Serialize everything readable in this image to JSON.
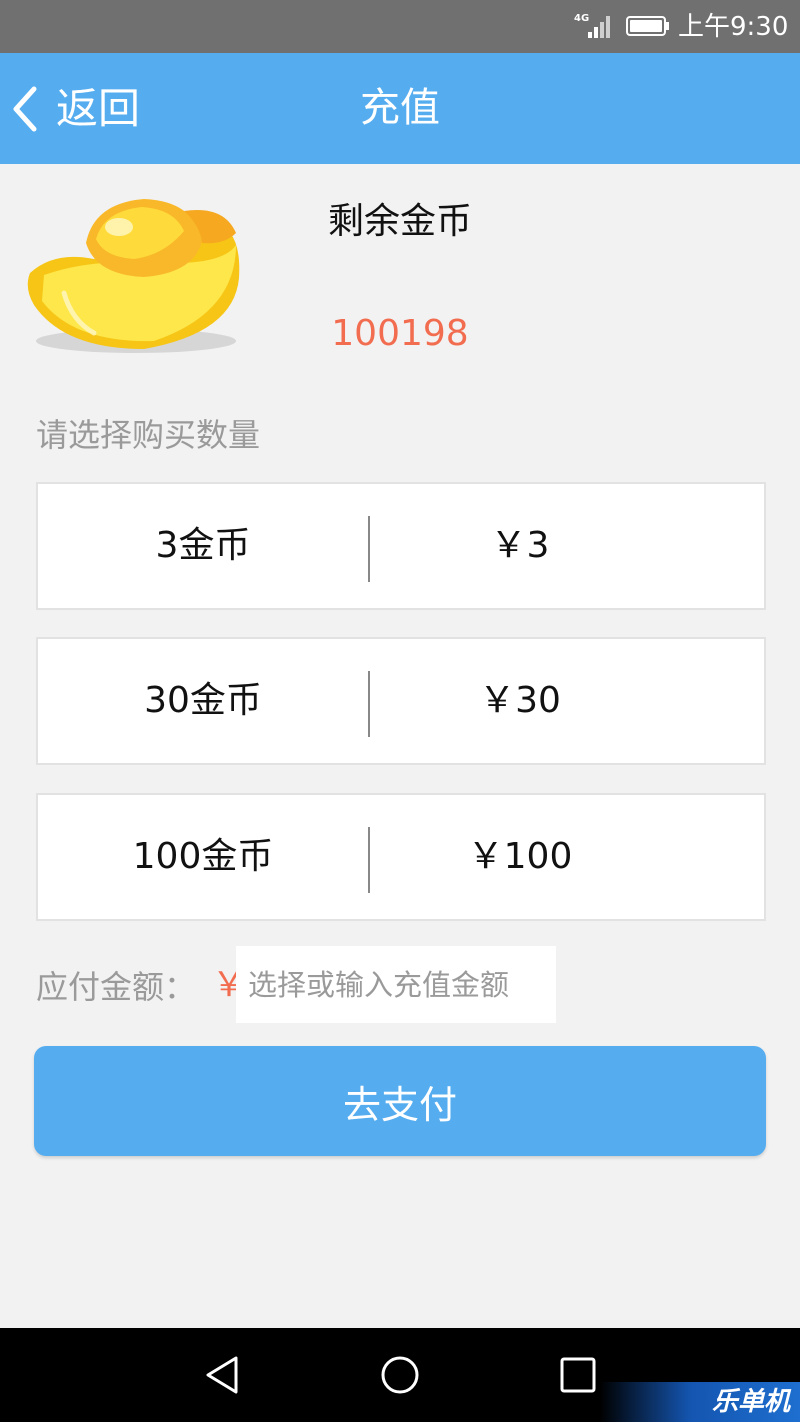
{
  "status_bar": {
    "network": "4G",
    "time": "上午9:30"
  },
  "nav": {
    "back_label": "返回",
    "title": "充值"
  },
  "balance": {
    "label": "剩余金币",
    "value": "100198"
  },
  "section_label": "请选择购买数量",
  "options": [
    {
      "coins": "3金币",
      "price": "￥3"
    },
    {
      "coins": "30金币",
      "price": "￥30"
    },
    {
      "coins": "100金币",
      "price": "￥100"
    }
  ],
  "payment": {
    "label": "应付金额：",
    "currency": "￥",
    "placeholder": "选择或输入充值金额",
    "value": ""
  },
  "pay_button_label": "去支付",
  "watermark": "乐单机",
  "colors": {
    "primary": "#55adf0",
    "accent": "#f26c4f",
    "status_bar": "#707070",
    "background": "#f2f2f2"
  },
  "icons": [
    "signal-icon",
    "battery-icon",
    "back-chevron-icon",
    "gold-ingot-icon",
    "back-triangle-icon",
    "home-circle-icon",
    "recents-square-icon"
  ]
}
